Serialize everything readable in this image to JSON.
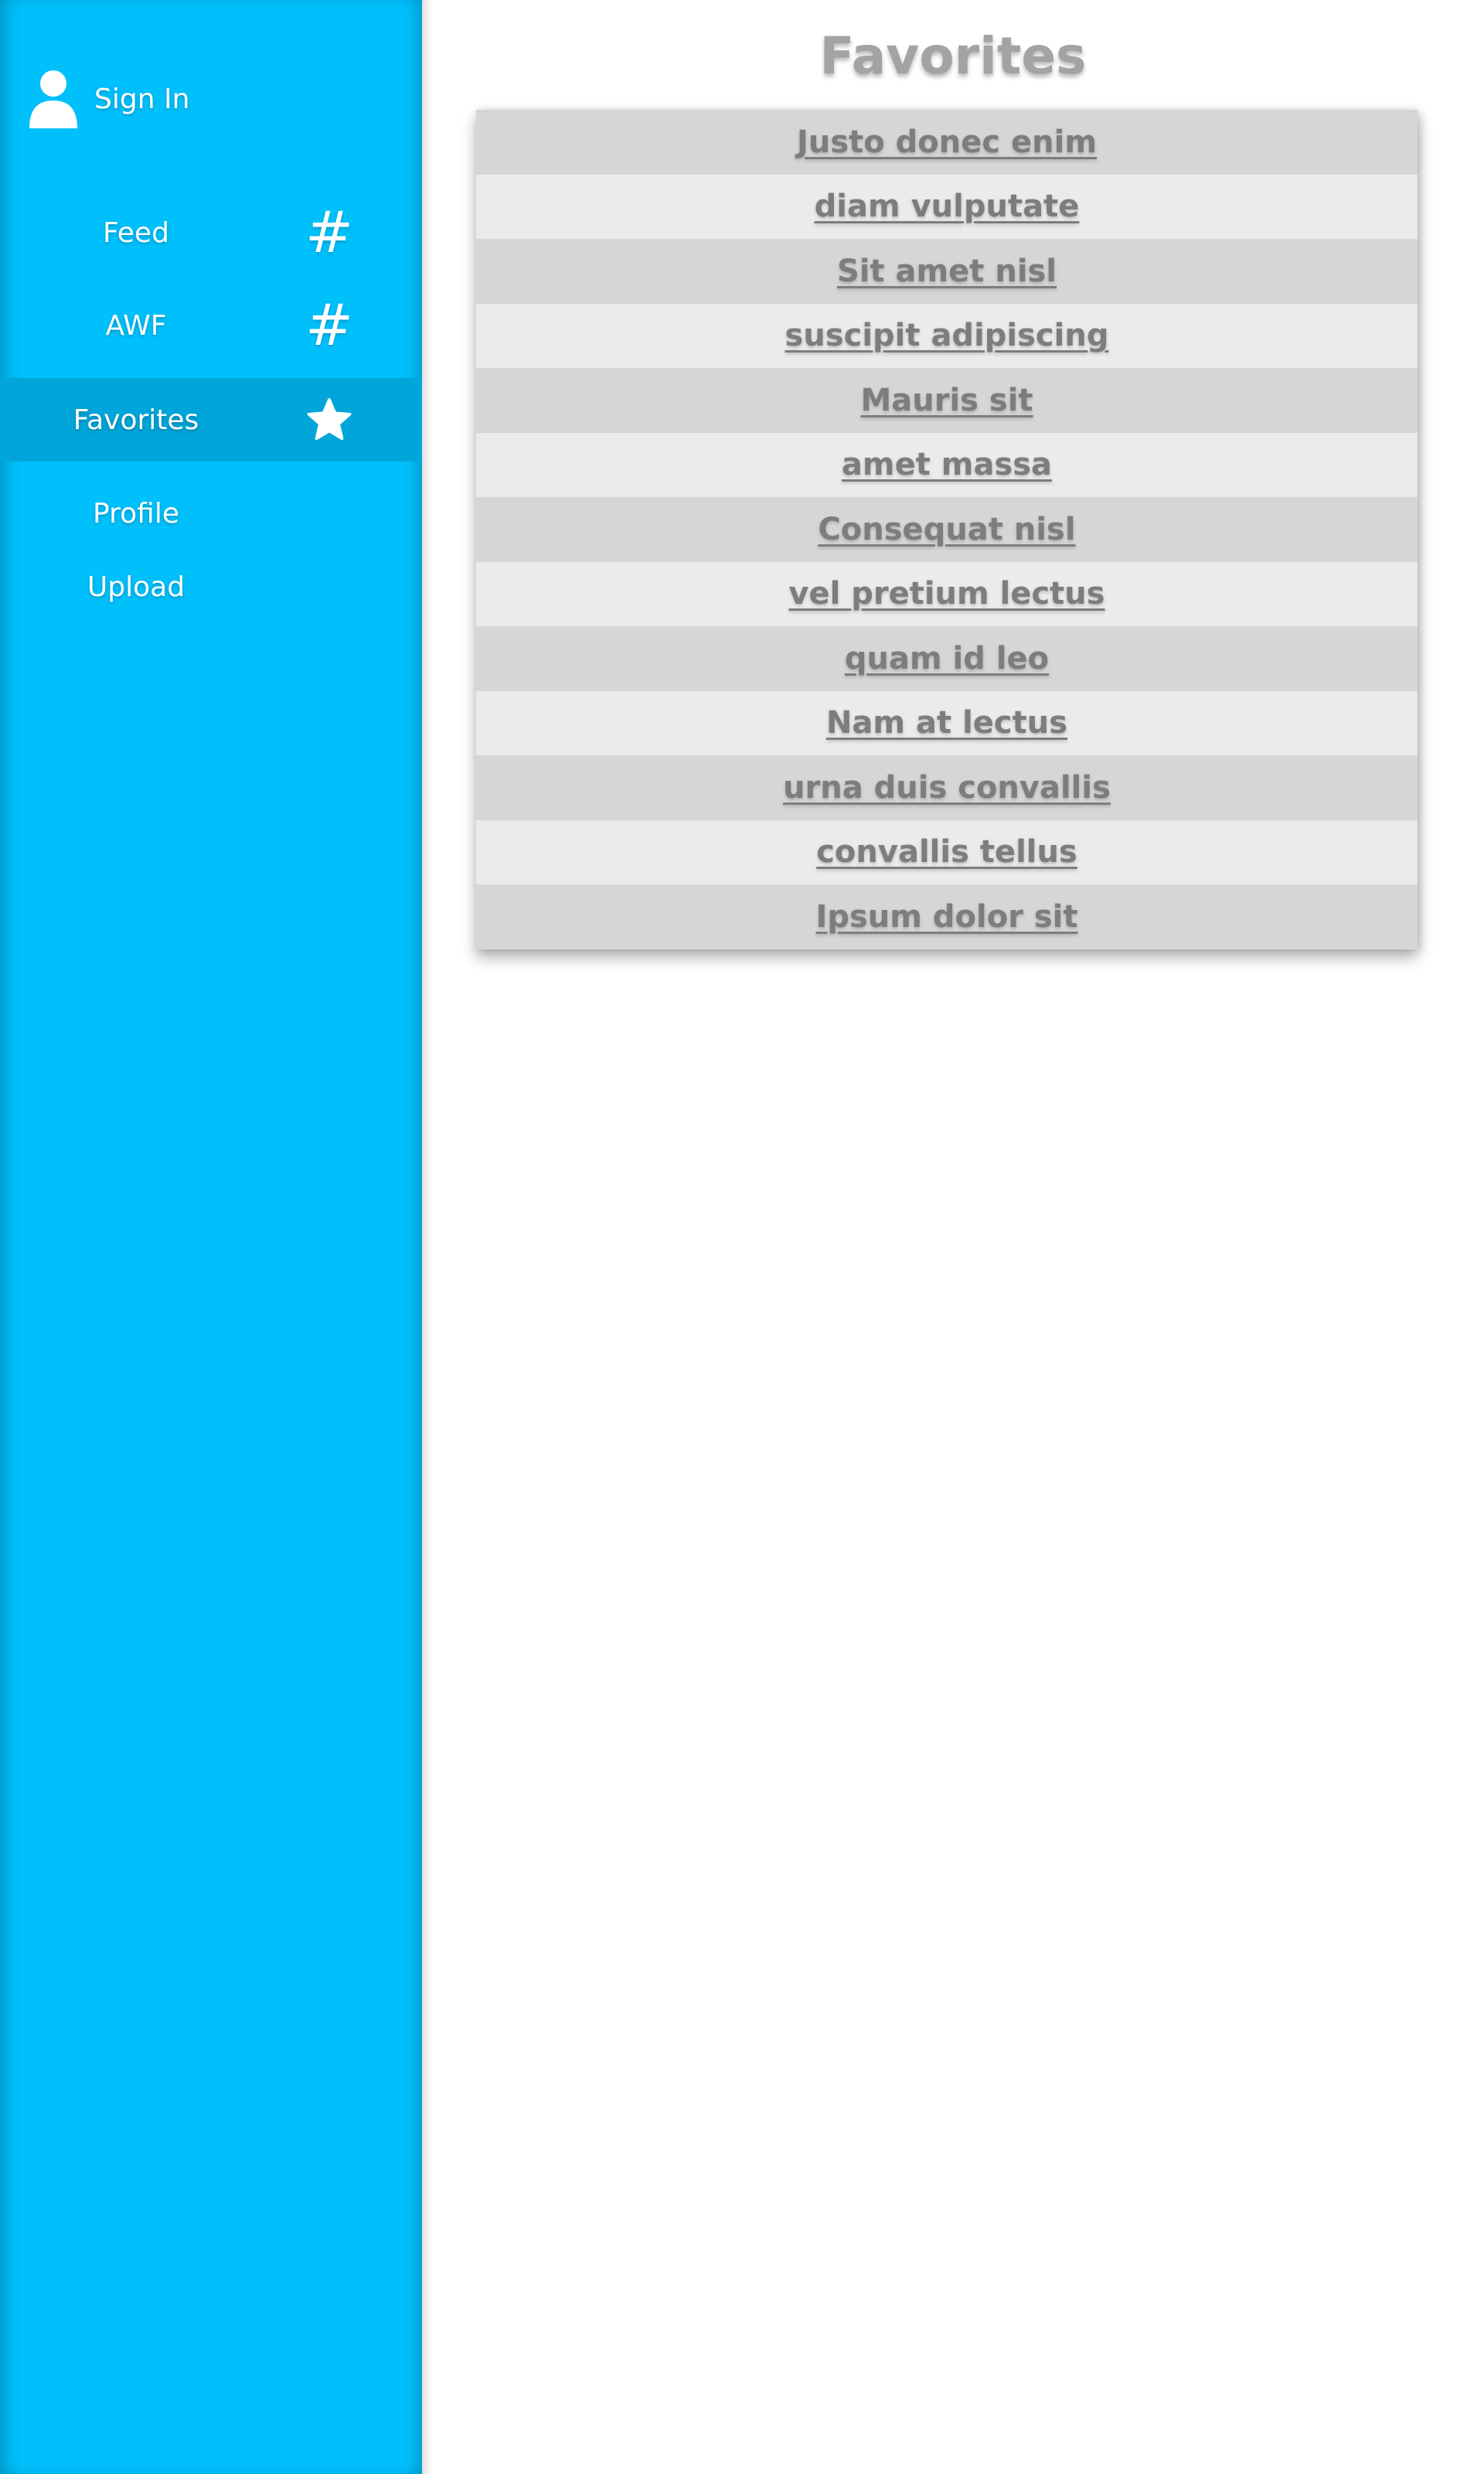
{
  "sidebar": {
    "sign_in": {
      "label": "Sign In",
      "icon": "user-icon"
    },
    "items": [
      {
        "label": "Feed",
        "icon": "hash-icon",
        "glyph": "#",
        "active": false
      },
      {
        "label": "AWF",
        "icon": "hash-icon",
        "glyph": "#",
        "active": false
      },
      {
        "label": "Favorites",
        "icon": "star-icon",
        "active": true
      },
      {
        "label": "Profile",
        "active": false
      },
      {
        "label": "Upload",
        "active": false
      }
    ]
  },
  "main": {
    "title": "Favorites",
    "favorites": [
      "Justo donec enim",
      "diam vulputate",
      "Sit amet nisl",
      "suscipit adipiscing",
      "Mauris sit",
      "amet massa",
      "Consequat nisl",
      "vel pretium lectus",
      "quam id leo",
      "Nam at lectus",
      "urna duis convallis",
      "convallis tellus",
      "Ipsum dolor sit"
    ]
  },
  "colors": {
    "sidebar_bg": "#00c0fc",
    "sidebar_active_bg": "#00a5d9",
    "title_text": "#a3a3a3",
    "link_text": "#7d7d7d",
    "row_odd": "#d6d6d6",
    "row_even": "#ebebeb"
  }
}
